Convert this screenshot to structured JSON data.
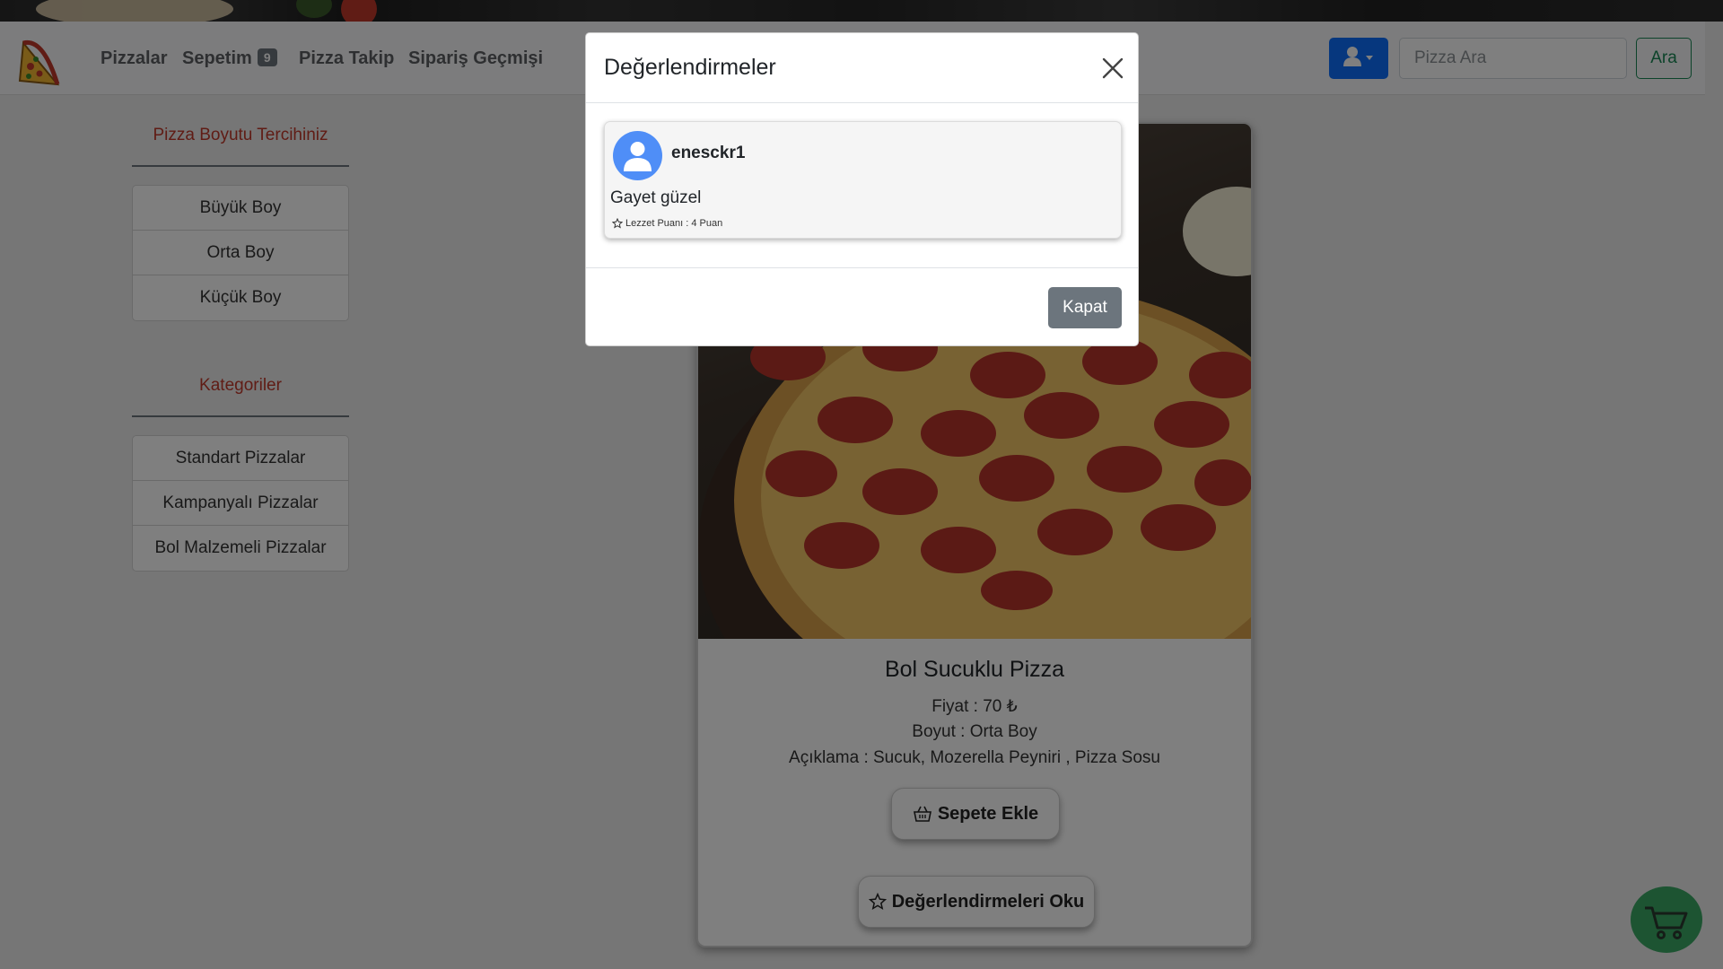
{
  "navbar": {
    "links": {
      "pizzalar": "Pizzalar",
      "sepetim": "Sepetim",
      "sepetim_count": "9",
      "pizza_takip": "Pizza Takip",
      "siparis_gecmisi": "Sipariş Geçmişi"
    },
    "search": {
      "placeholder": "Pizza Ara",
      "button": "Ara"
    }
  },
  "sidebar": {
    "size_title": "Pizza Boyutu Tercihiniz",
    "sizes": [
      "Büyük Boy",
      "Orta Boy",
      "Küçük Boy"
    ],
    "category_title": "Kategoriler",
    "categories": [
      "Standart Pizzalar",
      "Kampanyalı Pizzalar",
      "Bol Malzemeli Pizzalar"
    ]
  },
  "product": {
    "title": "Bol Sucuklu Pizza",
    "price": "Fiyat : 70 ₺",
    "size": "Boyut : Orta Boy",
    "description": "Açıklama : Sucuk, Mozerella Peyniri , Pizza Sosu",
    "add_to_cart": "Sepete Ekle",
    "read_reviews": "Değerlendirmeleri Oku"
  },
  "modal": {
    "title": "Değerlendirmeler",
    "reviews": [
      {
        "user": "enesckr1",
        "text": "Gayet güzel",
        "score": "Lezzet Puanı : 4 Puan"
      }
    ],
    "close_button": "Kapat"
  },
  "colors": {
    "primary": "#0d6efd",
    "success": "#198754",
    "secondary": "#6c757d",
    "accent_red": "#c0392b",
    "fab_green": "#3aa865"
  },
  "icons": {
    "logo": "pizza-slice-logo",
    "user": "user-icon",
    "basket": "basket-icon",
    "star": "star-outline-icon",
    "close": "close-icon",
    "cart": "cart-icon"
  }
}
